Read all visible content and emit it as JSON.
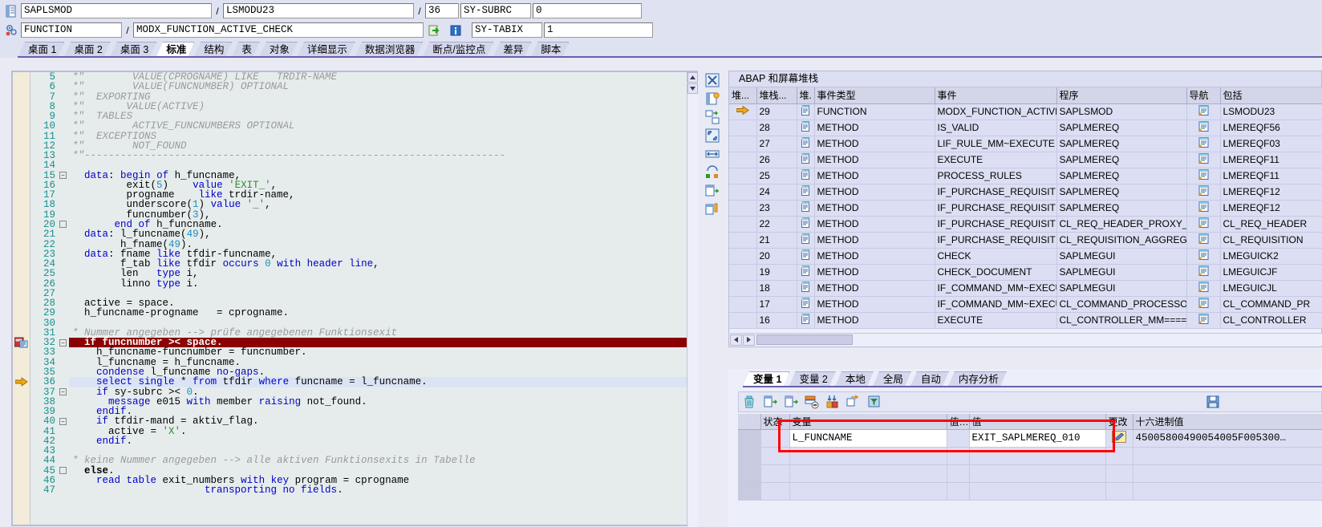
{
  "header": {
    "row1": {
      "icon": "program-icon",
      "program": "SAPLSMOD",
      "sep1": "/",
      "include": "LSMODU23",
      "sep2": "/",
      "line": "36",
      "subrc_label": "SY-SUBRC",
      "subrc_value": "0"
    },
    "row2": {
      "icon": "function-module-icon",
      "event_type": "FUNCTION",
      "sep1": "/",
      "event_name": "MODX_FUNCTION_ACTIVE_CHECK",
      "goto_icon": "goto-icon",
      "info_icon": "info-icon",
      "tabix_label": "SY-TABIX",
      "tabix_value": "1"
    }
  },
  "tabs": [
    {
      "label": "桌面 1",
      "active": false
    },
    {
      "label": "桌面 2",
      "active": false
    },
    {
      "label": "桌面 3",
      "active": false
    },
    {
      "label": "标准",
      "active": true
    },
    {
      "label": "结构",
      "active": false
    },
    {
      "label": "表",
      "active": false
    },
    {
      "label": "对象",
      "active": false
    },
    {
      "label": "详细显示",
      "active": false
    },
    {
      "label": "数据浏览器",
      "active": false
    },
    {
      "label": "断点/监控点",
      "active": false
    },
    {
      "label": "差异",
      "active": false
    },
    {
      "label": "脚本",
      "active": false
    }
  ],
  "code": {
    "breakpoint_line": 32,
    "current_line": 36,
    "lines": [
      {
        "n": 5,
        "html": "<span class='cm'>*&quot;        VALUE(CPROGNAME) LIKE   TRDIR-NAME</span>"
      },
      {
        "n": 6,
        "html": "<span class='cm'>*&quot;        VALUE(FUNCNUMBER) OPTIONAL</span>"
      },
      {
        "n": 7,
        "html": "<span class='cm'>*&quot;  EXPORTING</span>"
      },
      {
        "n": 8,
        "html": "<span class='cm'>*&quot;       VALUE(ACTIVE)</span>"
      },
      {
        "n": 9,
        "html": "<span class='cm'>*&quot;  TABLES</span>"
      },
      {
        "n": 10,
        "html": "<span class='cm'>*&quot;        ACTIVE_FUNCNUMBERS OPTIONAL</span>"
      },
      {
        "n": 11,
        "html": "<span class='cm'>*&quot;  EXCEPTIONS</span>"
      },
      {
        "n": 12,
        "html": "<span class='cm'>*&quot;        NOT_FOUND</span>"
      },
      {
        "n": 13,
        "html": "<span class='cm'>*&quot;----------------------------------------------------------------------</span>"
      },
      {
        "n": 14,
        "html": ""
      },
      {
        "n": 15,
        "html": "  <span class='kw'>data</span>: <span class='kw'>begin</span> <span class='kw'>of</span> h_funcname,"
      },
      {
        "n": 16,
        "html": "         exit(<span class='num'>5</span>)    <span class='kw'>value</span> <span class='str'>'EXIT_'</span>,"
      },
      {
        "n": 17,
        "html": "         progname    <span class='kw'>like</span> trdir-name,"
      },
      {
        "n": 18,
        "html": "         underscore(<span class='num'>1</span>) <span class='kw'>value</span> <span class='str'>'_'</span>,"
      },
      {
        "n": 19,
        "html": "         funcnumber(<span class='num'>3</span>),"
      },
      {
        "n": 20,
        "html": "       <span class='kw'>end</span> <span class='kw'>of</span> h_funcname."
      },
      {
        "n": 21,
        "html": "  <span class='kw'>data</span>: l_funcname(<span class='num'>49</span>),"
      },
      {
        "n": 22,
        "html": "        h_fname(<span class='num'>49</span>)."
      },
      {
        "n": 23,
        "html": "  <span class='kw'>data</span>: fname <span class='kw'>like</span> tfdir-funcname,"
      },
      {
        "n": 24,
        "html": "        f_tab <span class='kw'>like</span> tfdir <span class='kw'>occurs</span> <span class='num'>0</span> <span class='kw'>with header line</span>,"
      },
      {
        "n": 25,
        "html": "        len   <span class='kw'>type</span> i,"
      },
      {
        "n": 26,
        "html": "        linno <span class='kw'>type</span> i."
      },
      {
        "n": 27,
        "html": ""
      },
      {
        "n": 28,
        "html": "  active = space."
      },
      {
        "n": 29,
        "html": "  h_funcname-progname   = cprogname."
      },
      {
        "n": 30,
        "html": ""
      },
      {
        "n": 31,
        "html": "<span class='cm'>* Nummer angegeben --&gt; prüfe angegebenen Funktionsexit</span>"
      },
      {
        "n": 32,
        "html": "  <b>if funcnumber &gt;&lt; space.</b>"
      },
      {
        "n": 33,
        "html": "    h_funcname-funcnumber = funcnumber."
      },
      {
        "n": 34,
        "html": "    l_funcname = h_funcname."
      },
      {
        "n": 35,
        "html": "    <span class='kw'>condense</span> l_funcname <span class='kw'>no-gaps</span>."
      },
      {
        "n": 36,
        "html": "    <span class='kw'>select single</span> * <span class='kw'>from</span> tfdir <span class='kw'>where</span> funcname = l_funcname."
      },
      {
        "n": 37,
        "html": "    <span class='kw'>if</span> sy-subrc &gt;&lt; <span class='num'>0</span>."
      },
      {
        "n": 38,
        "html": "      <span class='kw'>message</span> e015 <span class='kw'>with</span> member <span class='kw'>raising</span> not_found."
      },
      {
        "n": 39,
        "html": "    <span class='kw'>endif</span>."
      },
      {
        "n": 40,
        "html": "    <span class='kw'>if</span> tfdir-mand = aktiv_flag."
      },
      {
        "n": 41,
        "html": "      active = <span class='str'>'X'</span>."
      },
      {
        "n": 42,
        "html": "    <span class='kw'>endif</span>."
      },
      {
        "n": 43,
        "html": ""
      },
      {
        "n": 44,
        "html": "<span class='cm'>* keine Nummer angegeben --&gt; alle aktiven Funktionsexits in Tabelle</span>"
      },
      {
        "n": 45,
        "html": "  <b>else</b>."
      },
      {
        "n": 46,
        "html": "    <span class='kw'>read table</span> exit_numbers <span class='kw'>with key</span> program = cprogname"
      },
      {
        "n": 47,
        "html": "                      <span class='kw'>transporting no fields</span>."
      }
    ]
  },
  "stack_panel": {
    "title": "ABAP 和屏幕堆栈",
    "columns": [
      "堆...",
      "堆栈...",
      "堆.",
      "事件类型",
      "事件",
      "程序",
      "导航",
      "包括"
    ],
    "rows": [
      {
        "marker": true,
        "level": "29",
        "type": "FUNCTION",
        "event": "MODX_FUNCTION_ACTIVE_…",
        "program": "SAPLSMOD",
        "include": "LSMODU23"
      },
      {
        "marker": false,
        "level": "28",
        "type": "METHOD",
        "event": "IS_VALID",
        "program": "SAPLMEREQ",
        "include": "LMEREQF56"
      },
      {
        "marker": false,
        "level": "27",
        "type": "METHOD",
        "event": "LIF_RULE_MM~EXECUTE",
        "program": "SAPLMEREQ",
        "include": "LMEREQF03"
      },
      {
        "marker": false,
        "level": "26",
        "type": "METHOD",
        "event": "EXECUTE",
        "program": "SAPLMEREQ",
        "include": "LMEREQF11"
      },
      {
        "marker": false,
        "level": "25",
        "type": "METHOD",
        "event": "PROCESS_RULES",
        "program": "SAPLMEREQ",
        "include": "LMEREQF11"
      },
      {
        "marker": false,
        "level": "24",
        "type": "METHOD",
        "event": "IF_PURCHASE_REQUISITION…",
        "program": "SAPLMEREQ",
        "include": "LMEREQF12"
      },
      {
        "marker": false,
        "level": "23",
        "type": "METHOD",
        "event": "IF_PURCHASE_REQUISITION…",
        "program": "SAPLMEREQ",
        "include": "LMEREQF12"
      },
      {
        "marker": false,
        "level": "22",
        "type": "METHOD",
        "event": "IF_PURCHASE_REQUISITION…",
        "program": "CL_REQ_HEADER_PROXY_M…",
        "include": "CL_REQ_HEADER"
      },
      {
        "marker": false,
        "level": "21",
        "type": "METHOD",
        "event": "IF_PURCHASE_REQUISITION…",
        "program": "CL_REQUISITION_AGGREGA…",
        "include": "CL_REQUISITION"
      },
      {
        "marker": false,
        "level": "20",
        "type": "METHOD",
        "event": "CHECK",
        "program": "SAPLMEGUI",
        "include": "LMEGUICK2"
      },
      {
        "marker": false,
        "level": "19",
        "type": "METHOD",
        "event": "CHECK_DOCUMENT",
        "program": "SAPLMEGUI",
        "include": "LMEGUICJF"
      },
      {
        "marker": false,
        "level": "18",
        "type": "METHOD",
        "event": "IF_COMMAND_MM~EXECUTE",
        "program": "SAPLMEGUI",
        "include": "LMEGUICJL"
      },
      {
        "marker": false,
        "level": "17",
        "type": "METHOD",
        "event": "IF_COMMAND_MM~EXECUTE",
        "program": "CL_COMMAND_PROCESSOR…",
        "include": "CL_COMMAND_PR"
      },
      {
        "marker": false,
        "level": "16",
        "type": "METHOD",
        "event": "EXECUTE",
        "program": "CL_CONTROLLER_MM====…",
        "include": "CL_CONTROLLER"
      }
    ]
  },
  "variables_panel": {
    "tabs": [
      {
        "label": "变量 1",
        "active": true
      },
      {
        "label": "变量 2",
        "active": false
      },
      {
        "label": "本地",
        "active": false
      },
      {
        "label": "全局",
        "active": false
      },
      {
        "label": "自动",
        "active": false
      },
      {
        "label": "内存分析",
        "active": false
      }
    ],
    "toolbar_icons": [
      "delete-icon",
      "copy-row-icon",
      "paste-row-icon",
      "remove-row-icon",
      "compare-icon",
      "transfer-icon",
      "filter-icon",
      "save-icon"
    ],
    "columns": [
      "",
      "状态",
      "变量",
      "值…",
      "值",
      "更改",
      "十六进制值"
    ],
    "rows": [
      {
        "status": "",
        "name": "L_FUNCNAME",
        "value_short": "",
        "value": "EXIT_SAPLMEREQ_010",
        "change_icon": "pencil-icon",
        "hex": "45005800490054005F005300…"
      },
      {
        "status": "",
        "name": "",
        "value_short": "",
        "value": "",
        "change_icon": "",
        "hex": ""
      },
      {
        "status": "",
        "name": "",
        "value_short": "",
        "value": "",
        "change_icon": "",
        "hex": ""
      },
      {
        "status": "",
        "name": "",
        "value_short": "",
        "value": "",
        "change_icon": "",
        "hex": ""
      }
    ]
  },
  "colors": {
    "accent": "#6a5fa8",
    "panel_bg": "#eceefa",
    "header_bg": "#dfe2f1",
    "breakpoint": "#8b0000",
    "highlight_box": "#ff0000",
    "code_bg": "#e6ecec"
  }
}
